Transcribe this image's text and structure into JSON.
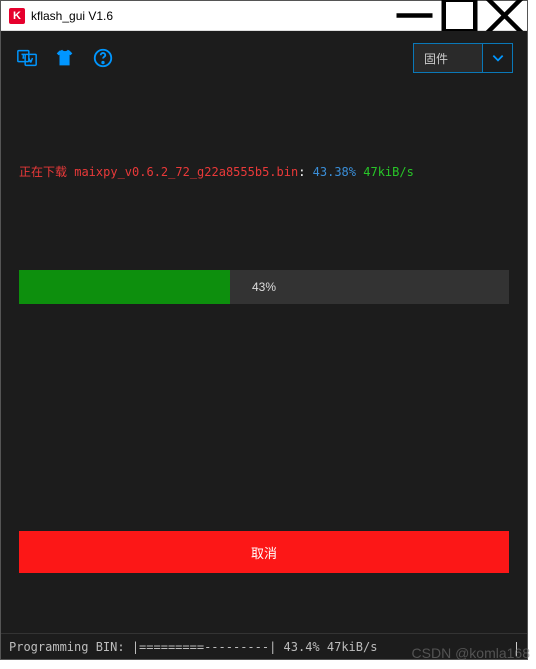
{
  "window": {
    "title": "kflash_gui V1.6",
    "icon_letter": "K"
  },
  "toolbar": {
    "dropdown_label": "固件"
  },
  "download": {
    "prefix": "正在下载 ",
    "filename": "maixpy_v0.6.2_72_g22a8555b5.bin",
    "colon": ": ",
    "percent": "43.38%",
    "speed": " 47kiB/s"
  },
  "progress": {
    "percent_value": 43,
    "percent_label": "43%"
  },
  "buttons": {
    "cancel": "取消"
  },
  "statusbar": {
    "text": "Programming BIN: |=========---------| 43.4% 47kiB/s"
  },
  "watermark": "CSDN @komla168"
}
